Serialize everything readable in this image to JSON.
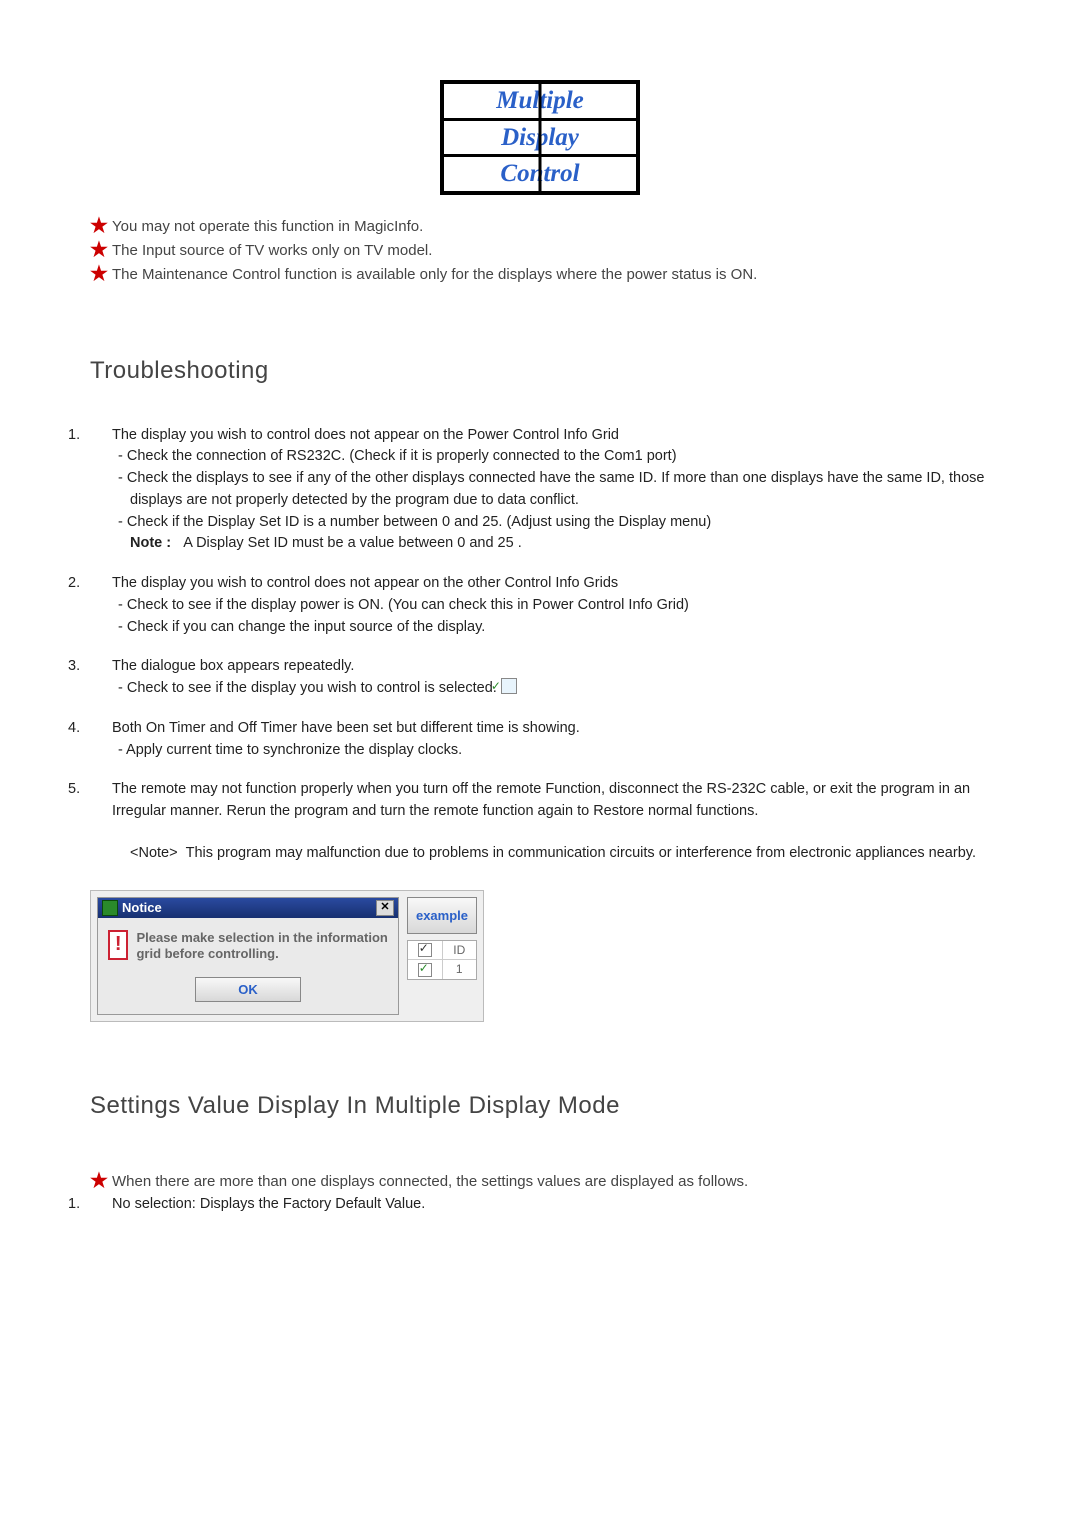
{
  "logo": {
    "line1": "Multiple",
    "line2": "Display",
    "line3": "Control"
  },
  "top_notes": [
    "You may not operate this function in MagicInfo.",
    "The Input source of TV works only on TV model.",
    "The Maintenance Control function is available only for the displays where the power status is ON."
  ],
  "troubleshooting": {
    "heading": "Troubleshooting",
    "items": [
      {
        "num": "1.",
        "head": "The display you wish to control does not appear on the Power Control Info Grid",
        "subs": [
          "- Check the connection of RS232C. (Check if it is properly connected to the Com1 port)",
          "- Check the displays to see if any of the other displays connected have the same ID. If more than one displays have the same ID, those displays are not properly detected by the program due to data conflict.",
          "- Check if the Display Set ID is a number between 0 and 25. (Adjust using the Display menu)"
        ],
        "note_label": "Note :",
        "note_text": "A Display Set ID must be a value between 0 and 25 ."
      },
      {
        "num": "2.",
        "head": "The display you wish to control does not appear on the other Control Info Grids",
        "subs": [
          "- Check to see if the display power is ON. (You can check this in Power Control Info Grid)",
          "- Check if you can change the input source of the display."
        ]
      },
      {
        "num": "3.",
        "head": "The dialogue box appears repeatedly.",
        "subs_with_check": "- Check to see if the display you wish to control is selected."
      },
      {
        "num": "4.",
        "head": "Both On Timer and Off Timer have been set but different time is showing.",
        "subs": [
          "- Apply current time to synchronize the display clocks."
        ]
      },
      {
        "num": "5.",
        "head": "The remote may not function properly when you turn off the remote Function, disconnect the RS-232C cable, or exit the program in an Irregular manner. Rerun the program and turn the remote function again to Restore normal functions."
      }
    ],
    "global_note_label": "<Note>",
    "global_note_text": "This program may malfunction due to problems in communication circuits or interference from electronic appliances nearby."
  },
  "dialog": {
    "title": "Notice",
    "message": "Please make selection in the information grid before controlling.",
    "ok": "OK",
    "example": "example",
    "id_header": "ID",
    "id_value": "1"
  },
  "section2": {
    "heading": "Settings Value Display In Multiple Display Mode",
    "star_note": "When there are more than one displays connected, the settings values are displayed as follows.",
    "item1_num": "1.",
    "item1": "No selection: Displays the Factory Default Value."
  }
}
